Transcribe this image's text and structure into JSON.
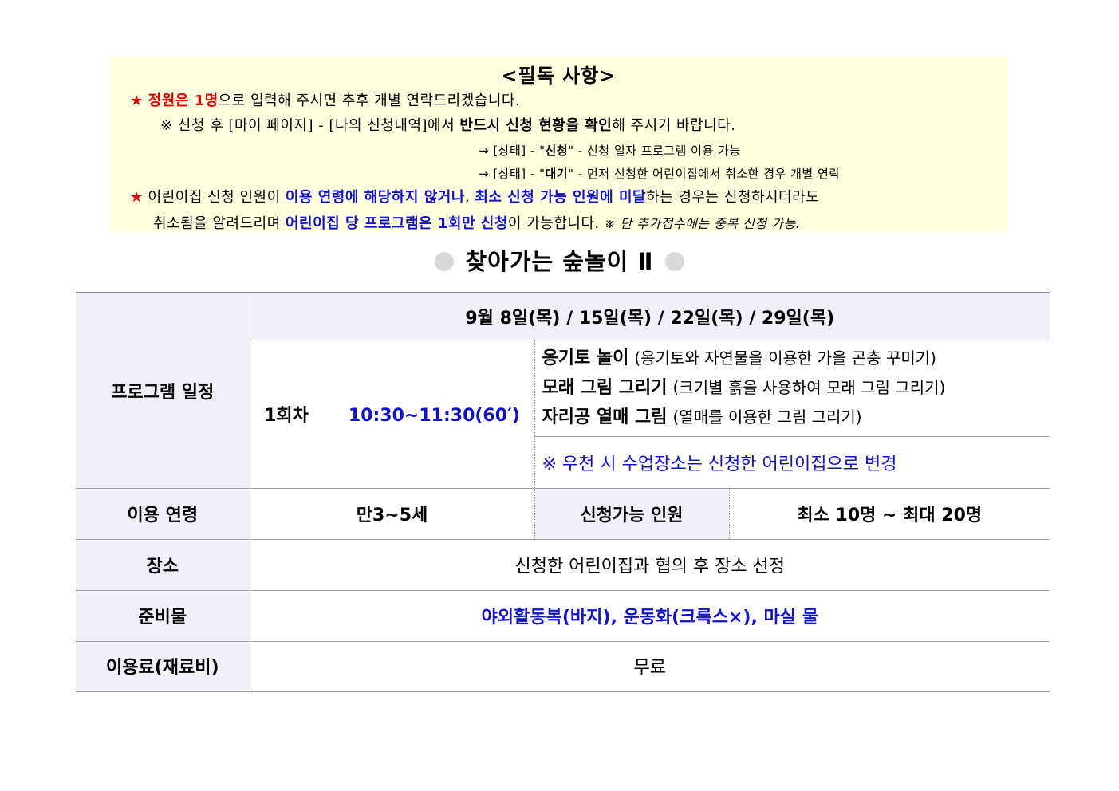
{
  "notice": {
    "title": "<필독 사항>",
    "star_icon": "★",
    "line1": {
      "red": "정원은 1명",
      "rest": "으로 입력해 주시면 추후 개별 연락드리겠습니다."
    },
    "line2": {
      "a": "※ 신청 후 [마이 페이지] - [나의 신청내역]에서 ",
      "b": "반드시 신청 현황을 확인",
      "c": "해 주시기 바랍니다."
    },
    "line3": {
      "a": "→ [상태] - \"",
      "b": "신청",
      "c": "\" - 신청 일자 프로그램 이용 가능"
    },
    "line4": {
      "a": "→ [상태] - \"",
      "b": "대기",
      "c": "\" - 먼저 신청한 어린이집에서 취소한 경우 개별 연락"
    },
    "line5": {
      "a": "어린이집 신청 인원이 ",
      "b": "이용 연령에 해당하지 않거나",
      "c": ", ",
      "d": "최소 신청 가능 인원에 미달",
      "e": "하는 경우는 신청하시더라도"
    },
    "line6": {
      "a": "취소됨을 알려드리며 ",
      "b": "어린이집 당 프로그램은 1회만 신청",
      "c": "이 가능합니다. ",
      "d": "※ 단 추가접수에는 중복 신청 가능."
    }
  },
  "heading": "찾아가는 숲놀이 Ⅱ",
  "table": {
    "schedule_label": "프로그램 일정",
    "dates": "9월 8일(목) / 15일(목) / 22일(목) / 29일(목)",
    "session_label": "1회차",
    "session_time": "10:30~11:30(60′)",
    "activities": [
      {
        "name": "옹기토 놀이",
        "desc": "(옹기토와 자연물을 이용한 가을 곤충 꾸미기)"
      },
      {
        "name": "모래 그림 그리기",
        "desc": "(크기별 흙을 사용하여 모래 그림 그리기)"
      },
      {
        "name": "자리공 열매 그림",
        "desc": "(열매를 이용한 그림 그리기)"
      }
    ],
    "rain_note": "※ 우천 시 수업장소는 신청한 어린이집으로 변경",
    "age_label": "이용 연령",
    "age_value": "만3~5세",
    "capacity_label": "신청가능 인원",
    "capacity_value": "최소 10명 ~ 최대 20명",
    "place_label": "장소",
    "place_value": "신청한 어린이집과 협의 후 장소 선정",
    "prep_label": "준비물",
    "prep_value": "야외활동복(바지), 운동화(크록스×), 마실 물",
    "fee_label": "이용료(재료비)",
    "fee_value": "무료"
  }
}
